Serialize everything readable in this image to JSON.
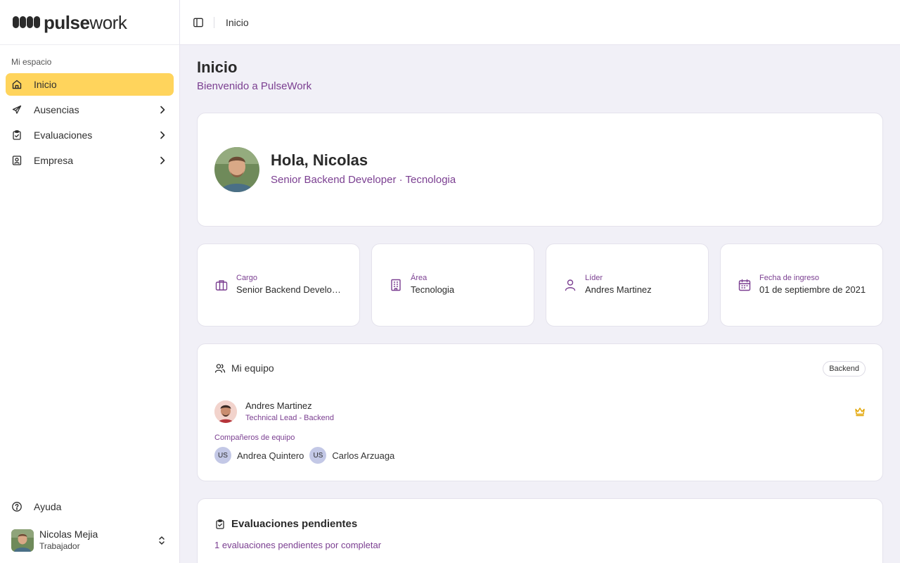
{
  "brand": {
    "bold": "pulse",
    "light": "work"
  },
  "sidebar": {
    "section_label": "Mi espacio",
    "items": [
      {
        "label": "Inicio",
        "icon": "home-icon",
        "active": true,
        "has_chevron": false
      },
      {
        "label": "Ausencias",
        "icon": "plane-icon",
        "active": false,
        "has_chevron": true
      },
      {
        "label": "Evaluaciones",
        "icon": "clipboard-check-icon",
        "active": false,
        "has_chevron": true
      },
      {
        "label": "Empresa",
        "icon": "id-badge-icon",
        "active": false,
        "has_chevron": true
      }
    ],
    "help_label": "Ayuda",
    "user": {
      "name": "Nicolas Mejia",
      "role": "Trabajador"
    }
  },
  "topbar": {
    "breadcrumb": "Inicio"
  },
  "page": {
    "title": "Inicio",
    "subtitle": "Bienvenido a PulseWork"
  },
  "hero": {
    "greeting": "Hola, Nicolas",
    "subtitle": "Senior Backend Developer · Tecnologia"
  },
  "info_cards": [
    {
      "key": "Cargo",
      "value": "Senior Backend Developer",
      "icon": "briefcase-icon"
    },
    {
      "key": "Área",
      "value": "Tecnologia",
      "icon": "building-icon"
    },
    {
      "key": "Líder",
      "value": "Andres Martinez",
      "icon": "user-icon"
    },
    {
      "key": "Fecha de ingreso",
      "value": "01 de septiembre de 2021",
      "icon": "calendar-icon"
    }
  ],
  "team": {
    "title": "Mi equipo",
    "badge": "Backend",
    "leader": {
      "name": "Andres Martinez",
      "role": "Technical Lead - Backend"
    },
    "mates_label": "Compañeros de equipo",
    "mates": [
      {
        "initials": "US",
        "name": "Andrea Quintero"
      },
      {
        "initials": "US",
        "name": "Carlos Arzuaga"
      }
    ]
  },
  "evaluations": {
    "title": "Evaluaciones pendientes",
    "subtitle": "1 evaluaciones pendientes por completar"
  },
  "colors": {
    "accent": "#ffd45c",
    "purple_text": "#7b3f91",
    "background": "#f1f0f7"
  }
}
